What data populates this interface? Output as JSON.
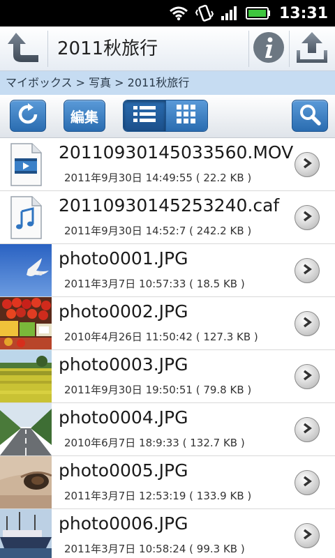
{
  "status_bar": {
    "time": "13:31",
    "icons": [
      "wifi-icon",
      "vibrate-icon",
      "signal-icon",
      "battery-icon"
    ]
  },
  "title_bar": {
    "title": "2011秋旅行",
    "back_icon": "back-arrow-icon",
    "info_icon": "info-icon",
    "upload_icon": "upload-icon"
  },
  "breadcrumb": {
    "text": "マイボックス > 写真 > 2011秋旅行"
  },
  "toolbar": {
    "refresh_icon": "refresh-icon",
    "edit_label": "編集",
    "list_view_icon": "list-view-icon",
    "grid_view_icon": "grid-view-icon",
    "search_icon": "search-icon",
    "active_view": "list"
  },
  "files": [
    {
      "name": "20110930145033560.MOV",
      "meta": "2011年9月30日 14:49:55 ( 22.2 KB )",
      "thumb": "video-file-icon"
    },
    {
      "name": "20110930145253240.caf",
      "meta": "2011年9月30日 14:52:7 ( 242.2 KB )",
      "thumb": "audio-file-icon"
    },
    {
      "name": "photo0001.JPG",
      "meta": "2011年3月7日 10:57:33 ( 18.5 KB )",
      "thumb": "seagull-sky-photo"
    },
    {
      "name": "photo0002.JPG",
      "meta": "2010年4月26日 11:50:42 ( 127.3 KB )",
      "thumb": "market-fruit-photo"
    },
    {
      "name": "photo0003.JPG",
      "meta": "2011年9月30日 19:50:51 ( 79.8 KB )",
      "thumb": "flower-field-photo"
    },
    {
      "name": "photo0004.JPG",
      "meta": "2010年6月7日 18:9:33 ( 132.7 KB )",
      "thumb": "road-photo"
    },
    {
      "name": "photo0005.JPG",
      "meta": "2011年3月7日 12:53:19 ( 133.9 KB )",
      "thumb": "animal-eye-photo"
    },
    {
      "name": "photo0006.JPG",
      "meta": "2011年3月7日 10:58:24 ( 99.3 KB )",
      "thumb": "harbor-boat-photo"
    }
  ]
}
